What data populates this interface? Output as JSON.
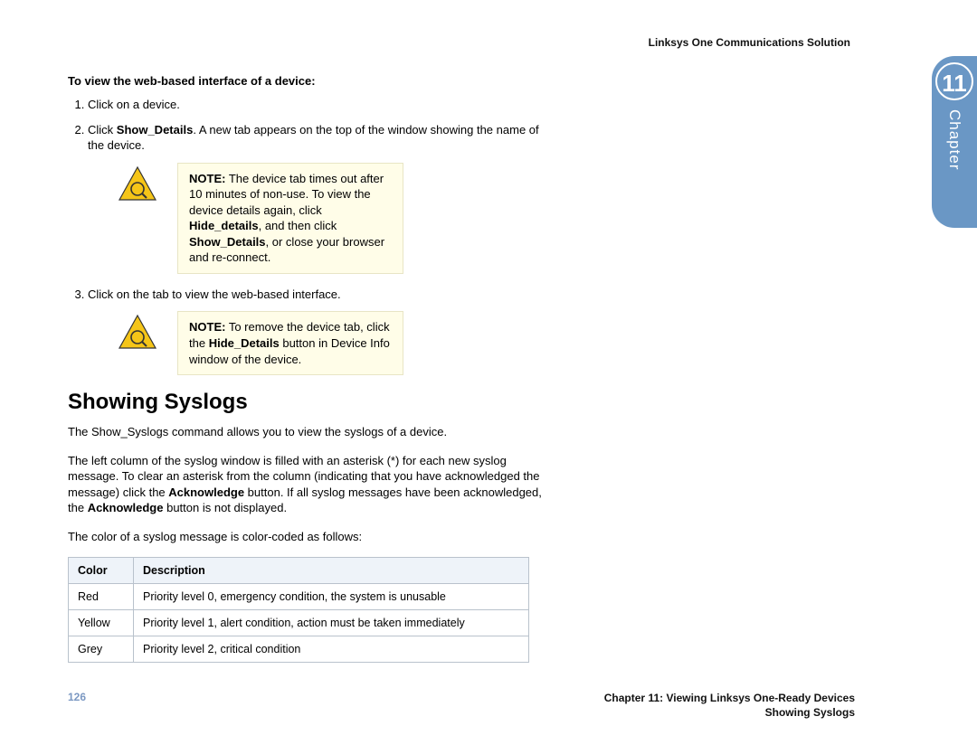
{
  "header": {
    "running": "Linksys One Communications Solution"
  },
  "chapterTab": {
    "number": "11",
    "label": "Chapter"
  },
  "procedure": {
    "title": "To view the web-based interface of a device:",
    "step1": "Click on a device.",
    "step2_prefix": "Click ",
    "step2_bold": "Show_Details",
    "step2_suffix": ". A new tab appears on the top of the window showing the name of the device.",
    "step3": "Click on the tab to view the web-based interface."
  },
  "note1": {
    "lead": "NOTE:",
    "t1": " The device tab times out after 10 minutes of non-use. To view the device details again, click ",
    "b1": "Hide_details",
    "t2": ", and then click ",
    "b2": "Show_Details",
    "t3": ", or close your browser and re-connect."
  },
  "note2": {
    "lead": "NOTE:",
    "t1": " To remove the device tab, click the ",
    "b1": "Hide_Details",
    "t2": " button in Device Info window of the device."
  },
  "section": {
    "title": "Showing Syslogs",
    "p1": "The Show_Syslogs command allows you to view the syslogs of a device.",
    "p2a": "The left column of the syslog window is filled with an asterisk (*) for each new syslog message. To clear an asterisk from the column (indicating that you have acknowledged the message) click the ",
    "p2b1": "Acknowledge",
    "p2b": " button. If all syslog messages have been acknowledged, the ",
    "p2b2": "Acknowledge",
    "p2c": " button is not displayed.",
    "p3": "The color of a syslog message is color-coded as follows:"
  },
  "table": {
    "h1": "Color",
    "h2": "Description",
    "rows": [
      {
        "c": "Red",
        "d": "Priority level 0, emergency condition, the system is unusable"
      },
      {
        "c": "Yellow",
        "d": "Priority level 1, alert condition, action must be taken immediately"
      },
      {
        "c": "Grey",
        "d": "Priority level 2, critical condition"
      }
    ]
  },
  "footer": {
    "page": "126",
    "line1": "Chapter 11: Viewing Linksys One-Ready Devices",
    "line2": "Showing Syslogs"
  }
}
